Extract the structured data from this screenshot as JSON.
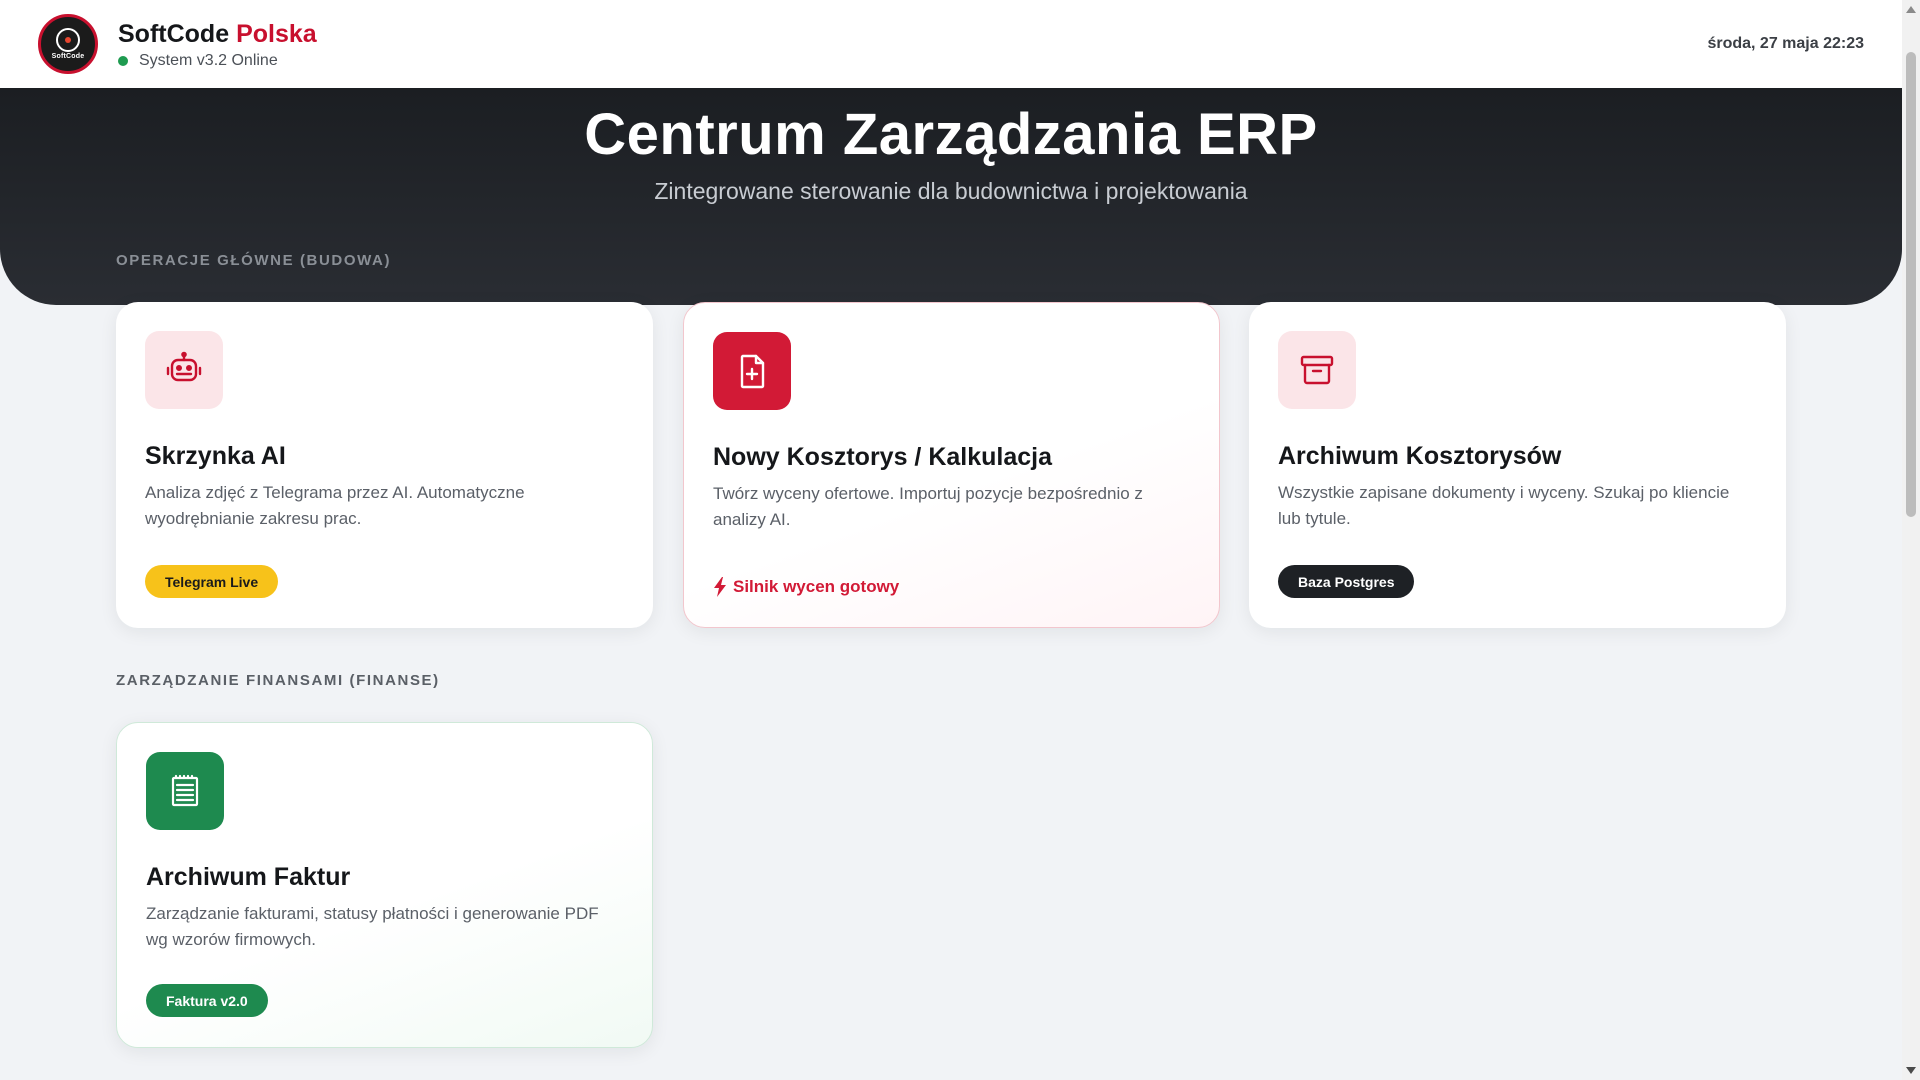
{
  "header": {
    "brand_primary": "SoftCode",
    "brand_accent": "Polska",
    "logo_text": "SoftCode",
    "status_text": "System v3.2 Online",
    "datetime": "środa, 27 maja 22:23"
  },
  "hero": {
    "title": "Centrum Zarządzania ERP",
    "subtitle": "Zintegrowane sterowanie dla budownictwa i projektowania"
  },
  "sections": {
    "operations_label": "OPERACJE GŁÓWNE (BUDOWA)",
    "finance_label": "ZARZĄDZANIE FINANSAMI (FINANSE)"
  },
  "cards": [
    {
      "icon": "robot-icon",
      "title": "Skrzynka AI",
      "description": "Analiza zdjęć z Telegrama przez AI. Automatyczne wyodrębnianie zakresu prac.",
      "badge": "Telegram Live"
    },
    {
      "icon": "file-plus-icon",
      "title": "Nowy Kosztorys / Kalkulacja",
      "description": "Twórz wyceny ofertowe. Importuj pozycje bezpośrednio z analizy AI.",
      "status": "Silnik wycen gotowy"
    },
    {
      "icon": "archive-box-icon",
      "title": "Archiwum Kosztorysów",
      "description": "Wszystkie zapisane dokumenty i wyceny. Szukaj po kliencie lub tytule.",
      "badge": "Baza Postgres"
    },
    {
      "icon": "invoice-icon",
      "title": "Archiwum Faktur",
      "description": "Zarządzanie fakturami, statusy płatności i generowanie PDF wg wzorów firmowych.",
      "badge": "Faktura v2.0"
    }
  ],
  "colors": {
    "brand_red": "#c8102e",
    "online_green": "#1e9b50",
    "hero_dark": "#1b1e22",
    "badge_yellow": "#f7c21a",
    "finance_green": "#1e8a4f"
  }
}
